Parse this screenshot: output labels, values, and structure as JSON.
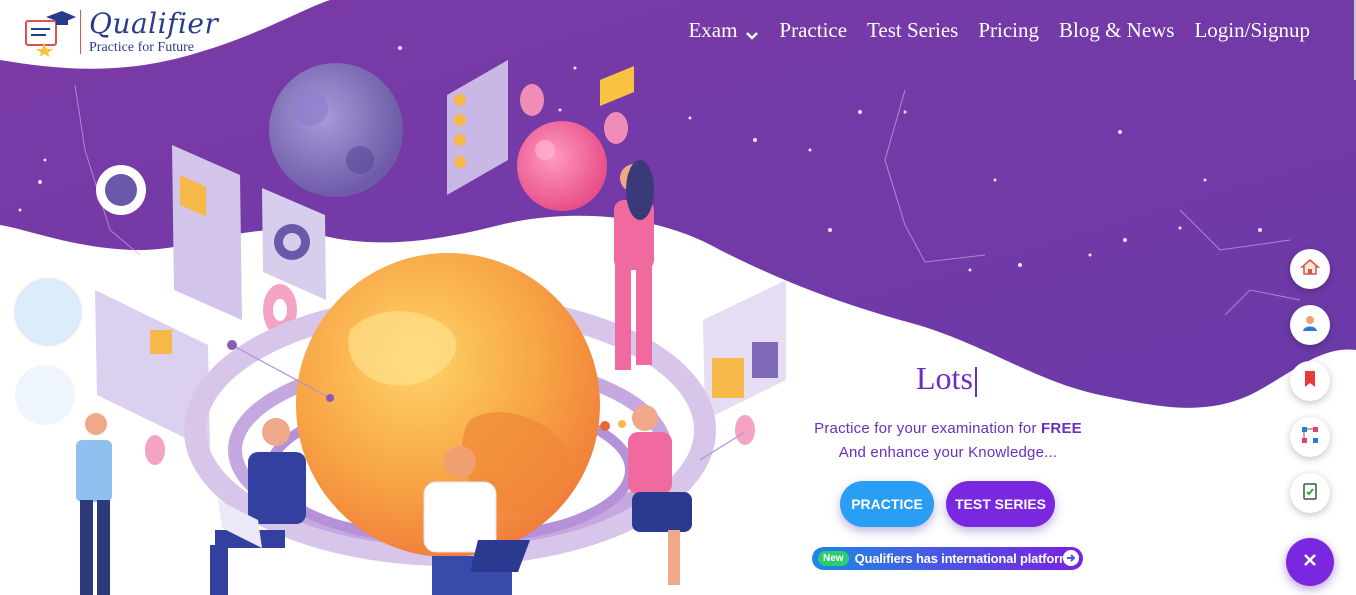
{
  "brand": {
    "name": "Qualifier",
    "tagline": "Practice for Future"
  },
  "nav": {
    "items": [
      {
        "label": "Exam",
        "icon": "chevron-down-icon"
      },
      {
        "label": "Practice"
      },
      {
        "label": "Test Series"
      },
      {
        "label": "Pricing"
      },
      {
        "label": "Blog & News"
      },
      {
        "label": "Login/Signup"
      }
    ]
  },
  "hero": {
    "typed_text": "Lots",
    "line1_prefix": "Practice for your examination for ",
    "line1_emphasis": "FREE",
    "line2": "And enhance your Knowledge...",
    "practice_button": "PRACTICE",
    "test_series_button": "TEST SERIES",
    "announcement_badge": "New",
    "announcement_text": "Qualifiers has international platform."
  },
  "side_actions": [
    {
      "icon": "home-icon"
    },
    {
      "icon": "user-icon"
    },
    {
      "icon": "bookmark-icon"
    },
    {
      "icon": "network-icon"
    },
    {
      "icon": "checklist-icon"
    }
  ],
  "colors": {
    "purple_dark": "#6b2fa0",
    "purple_light": "#7a3bb0",
    "accent_blue": "#2a9df4",
    "accent_violet": "#7a28e0",
    "text_violet": "#6a2fc0"
  }
}
